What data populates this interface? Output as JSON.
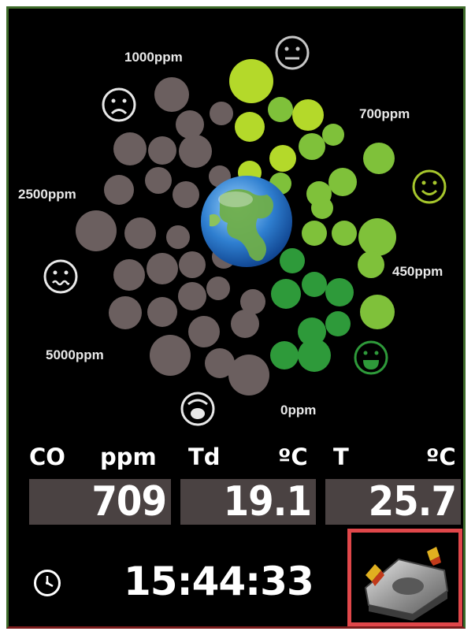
{
  "gauge": {
    "labels": {
      "ppm_1000": "1000ppm",
      "ppm_700": "700ppm",
      "ppm_2500": "2500ppm",
      "ppm_450": "450ppm",
      "ppm_5000": "5000ppm",
      "ppm_0": "0ppm"
    },
    "faces": [
      "neutral-face-icon",
      "sad-face-icon",
      "smile-face-icon",
      "queasy-face-icon",
      "grin-face-icon",
      "alarm-face-icon"
    ],
    "center_icon": "globe-icon",
    "colors": {
      "inactive": "#6b5f5f",
      "light_green": "#b4d92a",
      "mid_green": "#7fc13a",
      "dark_green": "#2e9a3a"
    }
  },
  "readings": {
    "co_label": "CO",
    "co_unit": "ppm",
    "co_value": "709",
    "td_label": "Td",
    "td_unit": "ºC",
    "td_value": "19.1",
    "t_label": "T",
    "t_unit": "ºC",
    "t_value": "25.7"
  },
  "clock": {
    "icon": "clock-icon",
    "time": "15:44:33"
  },
  "settings": {
    "icon": "settings-gear-icon"
  }
}
